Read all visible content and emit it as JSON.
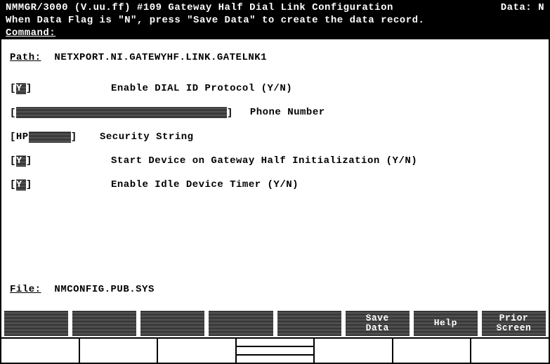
{
  "title_left": "NMMGR/3000 (V.uu.ff) #109  Gateway Half Dial Link Configuration",
  "title_right": "Data: N",
  "status_line": "When Data Flag is \"N\", press \"Save Data\" to create the data record.",
  "command_label": "Command:",
  "path_label": "Path:",
  "path_value": "NETXPORT.NI.GATEWYHF.LINK.GATELNK1",
  "fields": {
    "dial_id": {
      "value": "Y",
      "label": "Enable DIAL ID Protocol (Y/N)"
    },
    "phone": {
      "value": "",
      "label": "Phone Number"
    },
    "security": {
      "value": "HP",
      "label": "Security String"
    },
    "startdev": {
      "value": "Y",
      "label": "Start Device on Gateway Half Initialization (Y/N)"
    },
    "idle": {
      "value": "Y",
      "label": "Enable Idle Device Timer (Y/N)"
    }
  },
  "file_label": "File:",
  "file_value": "NMCONFIG.PUB.SYS",
  "fkeys": [
    "",
    "",
    "",
    "",
    "",
    "Save\nData",
    "Help",
    "Prior\nScreen"
  ]
}
